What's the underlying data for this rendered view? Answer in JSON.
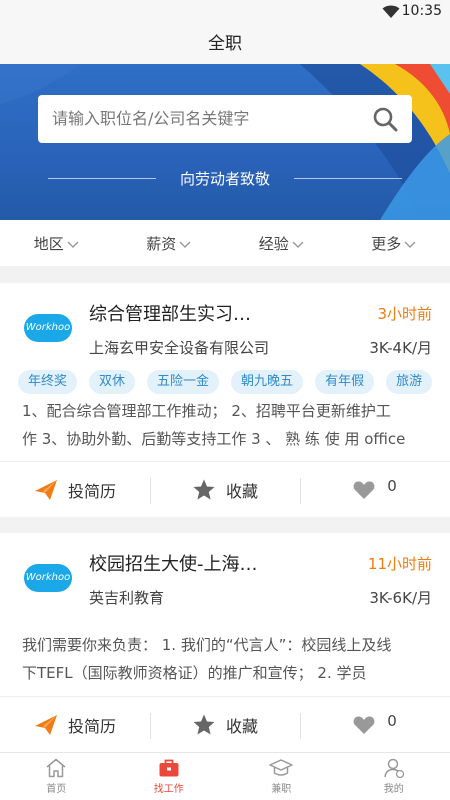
{
  "status": {
    "time": "10:35"
  },
  "header": {
    "title": "全职"
  },
  "search": {
    "placeholder": "请输入职位名/公司名关键字"
  },
  "banner": {
    "slogan": "向劳动者致敬"
  },
  "filters": [
    {
      "label": "地区"
    },
    {
      "label": "薪资"
    },
    {
      "label": "经验"
    },
    {
      "label": "更多"
    }
  ],
  "jobs": [
    {
      "title": "综合管理部生实习…",
      "time": "3小时前",
      "company": "上海玄甲安全设备有限公司",
      "salary": "3K-4K/月",
      "logo_text": "Workhoo",
      "tags": [
        "年终奖",
        "双休",
        "五险一金",
        "朝九晚五",
        "有年假",
        "旅游"
      ],
      "desc_line1": "1、配合综合管理部工作推动； 2、招聘平台更新维护工",
      "desc_line2": "作 3、协助外勤、后勤等支持工作 3 、 熟 练 使 用 office",
      "apply_label": "投简历",
      "fav_label": "收藏",
      "likes": "0"
    },
    {
      "title": "校园招生大使-上海…",
      "time": "11小时前",
      "company": "英吉利教育",
      "salary": "3K-6K/月",
      "logo_text": "Workhoo",
      "desc_line1": "我们需要你来负责： 1. 我们的“代言人”：校园线上及线",
      "desc_line2": "下TEFL（国际教师资格证）的推广和宣传； 2. 学员",
      "apply_label": "投简历",
      "fav_label": "收藏",
      "likes": "0"
    }
  ],
  "tabbar": [
    {
      "label": "首页",
      "icon": "home-icon"
    },
    {
      "label": "找工作",
      "icon": "briefcase-icon"
    },
    {
      "label": "兼职",
      "icon": "graduation-cap-icon"
    },
    {
      "label": "我的",
      "icon": "user-icon"
    }
  ],
  "colors": {
    "accent": "#ef7d13",
    "active_tab": "#e8493a",
    "tag_bg": "#e3f1fb",
    "tag_text": "#2f8bcb",
    "banner": "#2a64bb"
  }
}
